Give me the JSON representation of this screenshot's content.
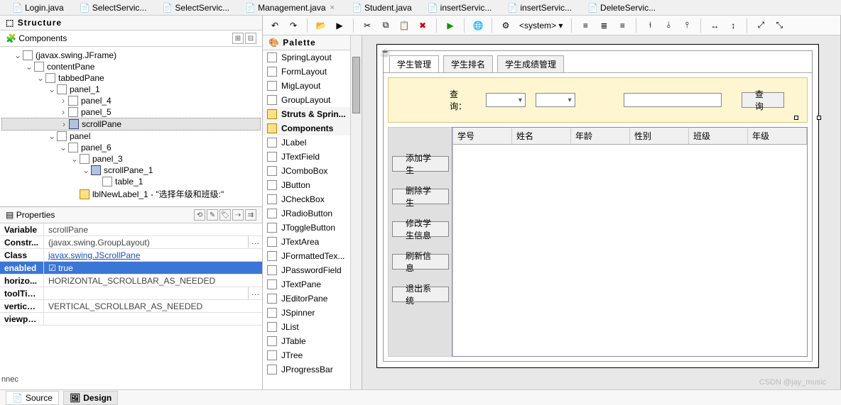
{
  "file_tabs": [
    "Login.java",
    "SelectServic...",
    "SelectServic...",
    "Management.java",
    "Student.java",
    "insertServic...",
    "insertServic...",
    "DeleteServic..."
  ],
  "structure_title": "Structure",
  "components_title": "Components",
  "tree": [
    {
      "d": 1,
      "t": "(javax.swing.JFrame)",
      "ico": "box",
      "tw": "v"
    },
    {
      "d": 2,
      "t": "contentPane",
      "ico": "cont",
      "tw": "v"
    },
    {
      "d": 3,
      "t": "tabbedPane",
      "ico": "cont",
      "tw": "v"
    },
    {
      "d": 4,
      "t": "panel_1",
      "ico": "cont",
      "tw": "v"
    },
    {
      "d": 5,
      "t": "panel_4",
      "ico": "cont",
      "tw": ">"
    },
    {
      "d": 5,
      "t": "panel_5",
      "ico": "cont",
      "tw": ">"
    },
    {
      "d": 5,
      "t": "scrollPane",
      "ico": "scroll",
      "tw": ">",
      "sel": true
    },
    {
      "d": 4,
      "t": "panel",
      "ico": "cont",
      "tw": "v"
    },
    {
      "d": 5,
      "t": "panel_6",
      "ico": "cont",
      "tw": "v"
    },
    {
      "d": 6,
      "t": "panel_3",
      "ico": "cont",
      "tw": "v"
    },
    {
      "d": 7,
      "t": "scrollPane_1",
      "ico": "scroll",
      "tw": "v"
    },
    {
      "d": 8,
      "t": "table_1",
      "ico": "table",
      "tw": ""
    },
    {
      "d": 6,
      "t": "lblNewLabel_1 - \"选择年级和班级:\"",
      "ico": "lbl",
      "tw": ""
    }
  ],
  "properties_title": "Properties",
  "properties": [
    {
      "k": "Variable",
      "v": "scrollPane"
    },
    {
      "k": "Constr...",
      "v": "(javax.swing.GroupLayout)",
      "dots": true
    },
    {
      "k": "Class",
      "v": "javax.swing.JScrollPane",
      "link": true
    },
    {
      "k": "enabled",
      "v": "true",
      "sel": true,
      "check": true
    },
    {
      "k": "horizo...",
      "v": "HORIZONTAL_SCROLLBAR_AS_NEEDED"
    },
    {
      "k": "toolTip...",
      "v": "",
      "dots": true
    },
    {
      "k": "vertical...",
      "v": "VERTICAL_SCROLLBAR_AS_NEEDED"
    },
    {
      "k": "viewpo...",
      "v": ""
    }
  ],
  "palette_title": "Palette",
  "palette": [
    {
      "t": "SpringLayout",
      "ico": "pal"
    },
    {
      "t": "FormLayout",
      "ico": "pal"
    },
    {
      "t": "MigLayout",
      "ico": "pal"
    },
    {
      "t": "GroupLayout",
      "ico": "pal"
    },
    {
      "t": "Struts & Sprin...",
      "ico": "folder",
      "hdr": true
    },
    {
      "t": "Components",
      "ico": "folder",
      "hdr": true
    },
    {
      "t": "JLabel",
      "ico": "pal"
    },
    {
      "t": "JTextField",
      "ico": "pal"
    },
    {
      "t": "JComboBox",
      "ico": "pal"
    },
    {
      "t": "JButton",
      "ico": "pal"
    },
    {
      "t": "JCheckBox",
      "ico": "pal"
    },
    {
      "t": "JRadioButton",
      "ico": "pal"
    },
    {
      "t": "JToggleButton",
      "ico": "pal"
    },
    {
      "t": "JTextArea",
      "ico": "pal"
    },
    {
      "t": "JFormattedTex...",
      "ico": "pal"
    },
    {
      "t": "JPasswordField",
      "ico": "pal"
    },
    {
      "t": "JTextPane",
      "ico": "pal"
    },
    {
      "t": "JEditorPane",
      "ico": "pal"
    },
    {
      "t": "JSpinner",
      "ico": "pal"
    },
    {
      "t": "JList",
      "ico": "pal"
    },
    {
      "t": "JTable",
      "ico": "pal"
    },
    {
      "t": "JTree",
      "ico": "pal"
    },
    {
      "t": "JProgressBar",
      "ico": "pal"
    }
  ],
  "toolbar": {
    "system_label": "<system>",
    "dropdown_glyph": "▾"
  },
  "app": {
    "tabs": [
      "学生管理",
      "学生排名",
      "学生成绩管理"
    ],
    "search_label": "查询：",
    "search_btn": "查询",
    "side_buttons": [
      "添加学生",
      "删除学生",
      "修改学生信息",
      "刷新信息",
      "退出系统"
    ],
    "columns": [
      "学号",
      "姓名",
      "年龄",
      "性别",
      "班级",
      "年级"
    ]
  },
  "bottom": {
    "source": "Source",
    "design": "Design"
  },
  "watermark": "CSDN @jay_music",
  "nnec": "nnec"
}
